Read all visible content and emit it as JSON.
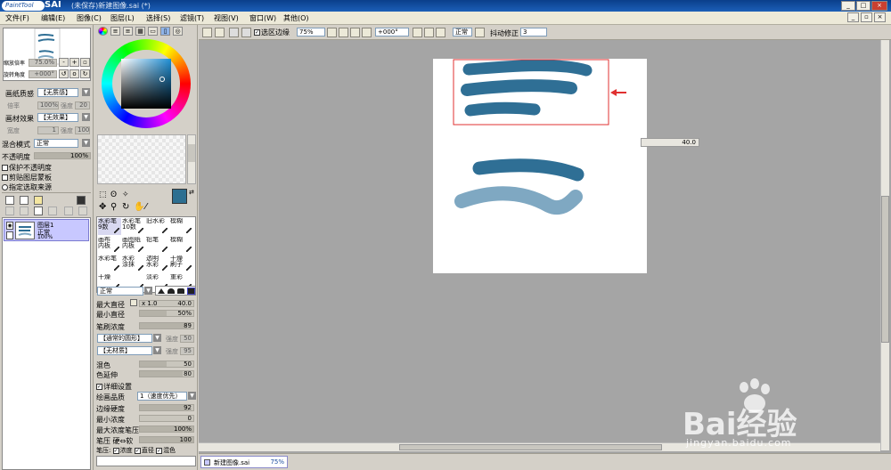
{
  "window": {
    "logo_text": "PaintTool",
    "app_name": "SAI",
    "title": "(未保存)新建图像.sai (*)"
  },
  "menu": {
    "items": [
      "文件(F)",
      "编辑(E)",
      "图像(C)",
      "图层(L)",
      "选择(S)",
      "滤镜(T)",
      "视图(V)",
      "窗口(W)",
      "其他(O)"
    ]
  },
  "navigator": {
    "zoom_label": "缩放倍率",
    "zoom_value": "75.0%",
    "rotate_label": "旋转角度",
    "rotate_value": "+000°"
  },
  "layer_props": {
    "paper_texture_label": "画纸质感",
    "paper_texture_value": "【无质感】",
    "scale_label": "倍率",
    "scale_value": "100%",
    "intensity_label": "强度",
    "intensity_value": "20",
    "material_effect_label": "画材效果",
    "material_effect_value": "【无效果】",
    "width_label": "宽度",
    "width_value": "1",
    "intensity2_label": "强度",
    "intensity2_value": "100",
    "blend_label": "混合模式",
    "blend_value": "正常",
    "opacity_label": "不透明度",
    "opacity_value": "100%",
    "opacity_fraction": 1.0,
    "preserve_opacity": "保护不透明度",
    "clip_group": "剪贴图层蒙板",
    "sel_source": "指定选取来源"
  },
  "layer": {
    "name": "图层1",
    "mode": "正常",
    "opacity": "100%"
  },
  "tools": {
    "brushes": [
      [
        "水彩笔",
        "9数"
      ],
      [
        "水彩笔",
        "10数"
      ],
      [
        "旧水彩",
        ""
      ],
      [
        "模糊",
        ""
      ],
      [
        "画布",
        "内板"
      ],
      [
        "画图纸",
        "内板"
      ],
      [
        "铅笔",
        ""
      ],
      [
        "模糊",
        ""
      ],
      [
        "水彩笔",
        ""
      ],
      [
        "水彩",
        "涂抹"
      ],
      [
        "透明",
        "水彩"
      ],
      [
        "干燥",
        "刷子"
      ],
      [
        "干燥",
        ""
      ],
      [
        "",
        ""
      ],
      [
        "淡彩",
        ""
      ],
      [
        "重彩",
        ""
      ]
    ],
    "primary_color": "#2d6f91",
    "brush_mode": "正常",
    "max_size_label": "最大直径",
    "max_size_mult": "x 1.0",
    "max_size_value": "40.0",
    "min_size_label": "最小直径",
    "min_size_value": "50%",
    "min_size_fraction": 0.5,
    "density_label": "笔刷浓度",
    "density_value": "89",
    "density_fraction": 0.89,
    "shape_value": "【通常的圆形】",
    "shape_intensity_label": "强度",
    "shape_intensity_value": "50",
    "texture_value": "【无材质】",
    "texture_intensity_label": "强度",
    "texture_intensity_value": "95",
    "mix_label": "混色",
    "mix_value": "50",
    "mix_fraction": 0.5,
    "dilution_label": "色延伸",
    "dilution_value": "80",
    "dilution_fraction": 0.8,
    "detail_label": "详细设置",
    "quality_label": "绘画品质",
    "quality_value": "1（速度优先）",
    "edge_label": "边缘硬度",
    "edge_value": "92",
    "edge_fraction": 0.92,
    "min_density_label": "最小浓度",
    "min_density_value": "0",
    "min_density_fraction": 0.0,
    "max_pressure_label": "最大浓度笔压",
    "max_pressure_value": "100%",
    "max_pressure_fraction": 1.0,
    "pressure_hard_label": "笔压 硬⇔软",
    "pressure_hard_value": "100",
    "pressure_hard_fraction": 1.0,
    "pressure_row_label": "笔压:",
    "pressure_density": "浓度",
    "pressure_size": "直径",
    "pressure_blend": "混色"
  },
  "canvas_toolbar": {
    "selection_edge": "选区边缘",
    "zoom": "75%",
    "angle": "+000°",
    "mode": "正常",
    "stabilizer_label": "抖动修正",
    "stabilizer_value": "3"
  },
  "canvas": {
    "size_readout": "40.0"
  },
  "status": {
    "doc_name": "新建图像.sai",
    "doc_zoom": "75%"
  },
  "watermark": {
    "text": "Bai经验",
    "url": "jingyan.baidu.com"
  },
  "colors": {
    "stroke_dark": "#2f6f95",
    "stroke_light": "#7fa8c2",
    "highlight_box": "#e03030",
    "layer_selected": "#c8c8ff"
  }
}
